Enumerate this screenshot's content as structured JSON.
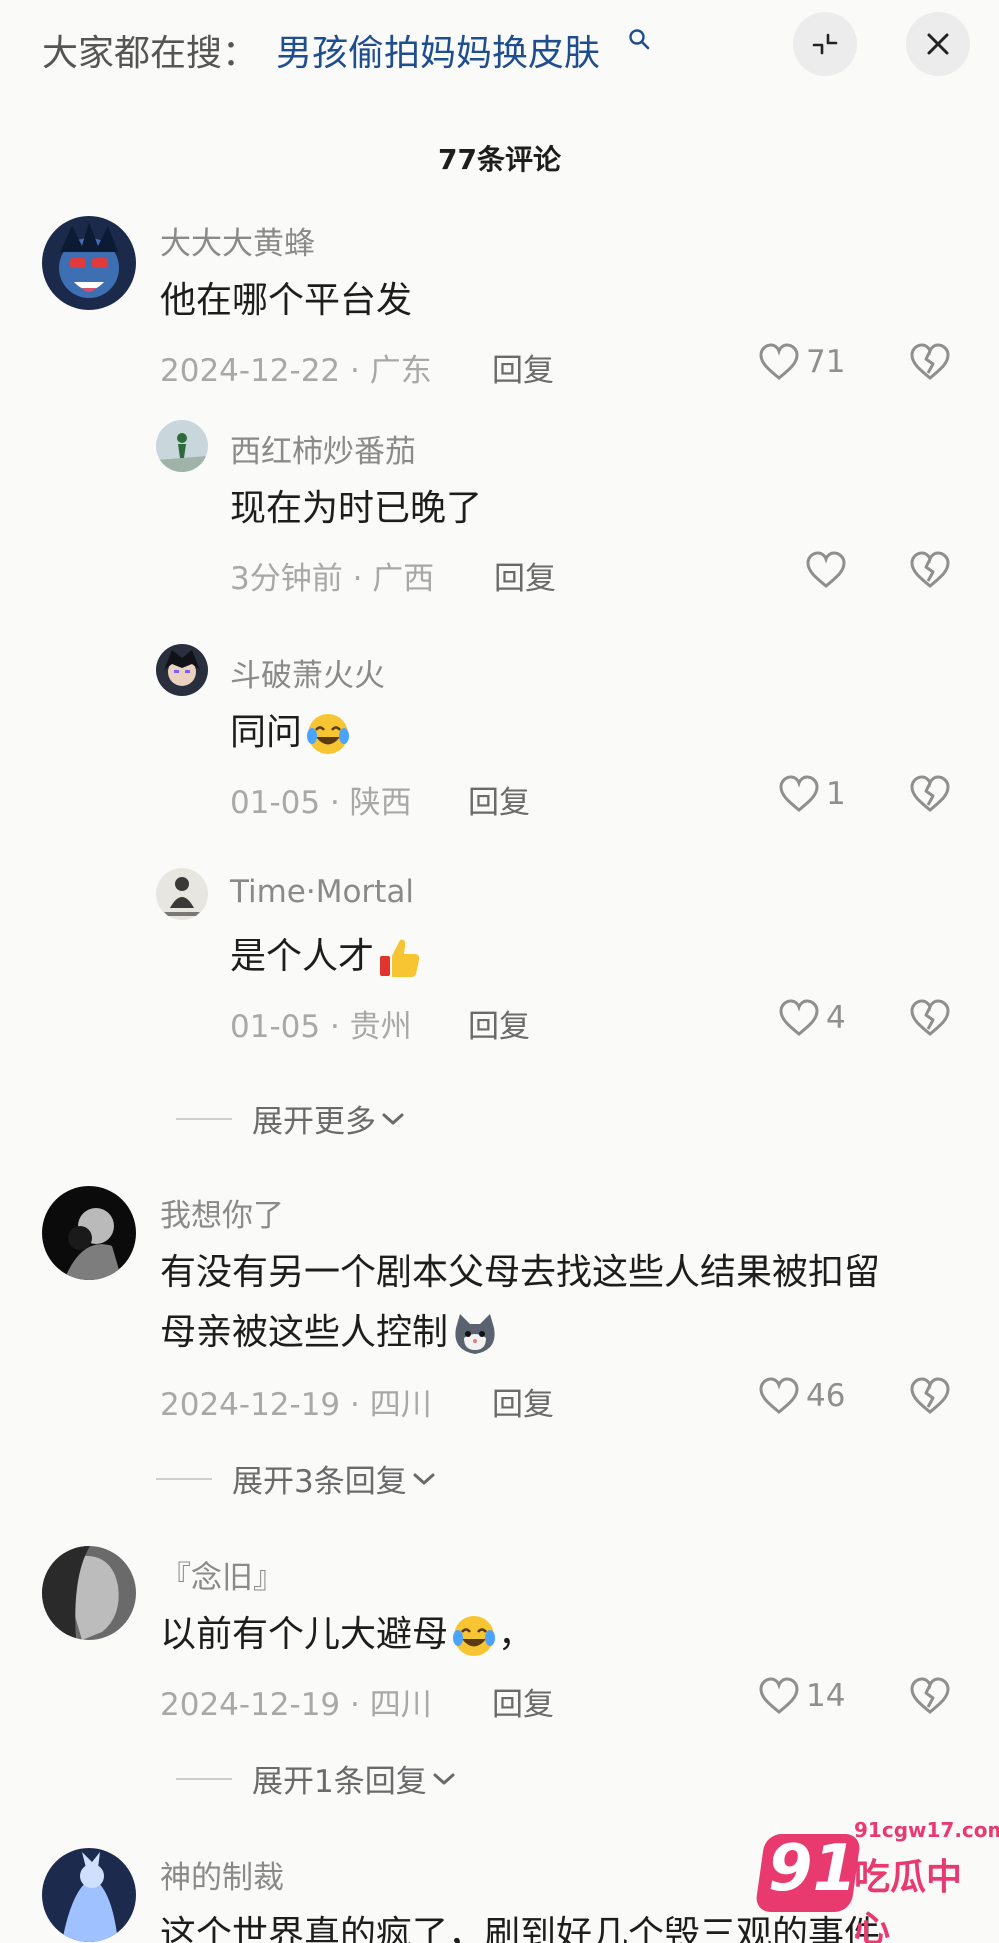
{
  "header": {
    "search_prefix": "大家都在搜：",
    "search_term": "男孩偷拍妈妈换皮肤",
    "collapse_icon": "collapse-icon",
    "close_icon": "close-icon"
  },
  "comment_count": "77条评论",
  "reply_label": "回复",
  "comments": [
    {
      "user": "大大大黄蜂",
      "text": "他在哪个平台发",
      "date": "2024-12-22",
      "region": "广东",
      "likes": "71",
      "replies": [
        {
          "user": "西红柿炒番茄",
          "text": "现在为时已晚了",
          "date": "3分钟前",
          "region": "广西",
          "likes": ""
        },
        {
          "user": "斗破萧火火",
          "text": "同问",
          "date": "01-05",
          "region": "陕西",
          "likes": "1"
        },
        {
          "user": "Time·Mortal",
          "text": "是个人才",
          "date": "01-05",
          "region": "贵州",
          "likes": "4"
        }
      ],
      "expand": "展开更多"
    },
    {
      "user": "我想你了",
      "text_line1": "有没有另一个剧本父母去找这些人结果被扣留",
      "text_line2": "母亲被这些人控制",
      "date": "2024-12-19",
      "region": "四川",
      "likes": "46",
      "expand": "展开3条回复"
    },
    {
      "user": "『念旧』",
      "text": "以前有个儿大避母",
      "text_suffix": "，",
      "date": "2024-12-19",
      "region": "四川",
      "likes": "14",
      "expand": "展开1条回复"
    },
    {
      "user": "神的制裁",
      "text": "这个世界真的疯了，刷到好几个毁三观的事件"
    }
  ],
  "watermark": {
    "number": "91",
    "url": "91cgw17.com",
    "name": "吃瓜中心"
  }
}
